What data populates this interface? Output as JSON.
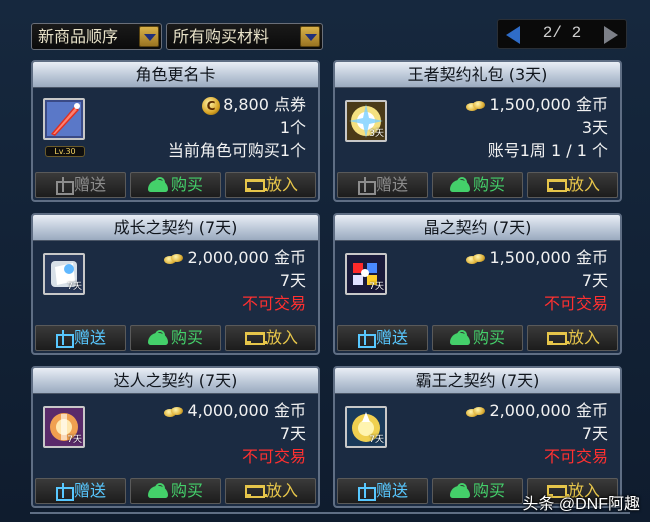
{
  "toolbar": {
    "sort_label": "新商品顺序",
    "filter_label": "所有购买材料"
  },
  "pager": {
    "text": "2/ 2"
  },
  "buttons": {
    "gift": "赠送",
    "buy": "购买",
    "cart": "放入"
  },
  "items": [
    {
      "title": "角色更名卡",
      "icon": "rename-card-icon",
      "level_badge": "Lv.30",
      "price": "8,800",
      "currency": "点券",
      "line2": "1个",
      "line3": "当前角色可购买1个",
      "line3_red": false,
      "gift_enabled": false
    },
    {
      "title": "王者契约礼包 (3天)",
      "icon": "king-contract-pack-icon",
      "days_badge": "3天",
      "price": "1,500,000",
      "currency": "金币",
      "line2": "3天",
      "line3": "账号1周 1 / 1 个",
      "line3_red": false,
      "gift_enabled": false
    },
    {
      "title": "成长之契约 (7天)",
      "icon": "growth-contract-icon",
      "days_badge": "7天",
      "price": "2,000,000",
      "currency": "金币",
      "line2": "7天",
      "line3": "不可交易",
      "line3_red": true,
      "gift_enabled": true
    },
    {
      "title": "晶之契约 (7天)",
      "icon": "crystal-contract-icon",
      "days_badge": "7天",
      "price": "1,500,000",
      "currency": "金币",
      "line2": "7天",
      "line3": "不可交易",
      "line3_red": true,
      "gift_enabled": true
    },
    {
      "title": "达人之契约 (7天)",
      "icon": "expert-contract-icon",
      "days_badge": "7天",
      "price": "4,000,000",
      "currency": "金币",
      "line2": "7天",
      "line3": "不可交易",
      "line3_red": true,
      "gift_enabled": true
    },
    {
      "title": "霸王之契约 (7天)",
      "icon": "overlord-contract-icon",
      "days_badge": "7天",
      "price": "2,000,000",
      "currency": "金币",
      "line2": "7天",
      "line3": "不可交易",
      "line3_red": true,
      "gift_enabled": true
    }
  ],
  "watermark": "头条 @DNF阿趣",
  "colors": {
    "card_bg": "#1b2b42",
    "title_bar": "#bcc8d8",
    "red_text": "#ff3030",
    "gift_active": "#58c8ff",
    "buy_green": "#44d06a",
    "cart_gold": "#e6c54a"
  }
}
